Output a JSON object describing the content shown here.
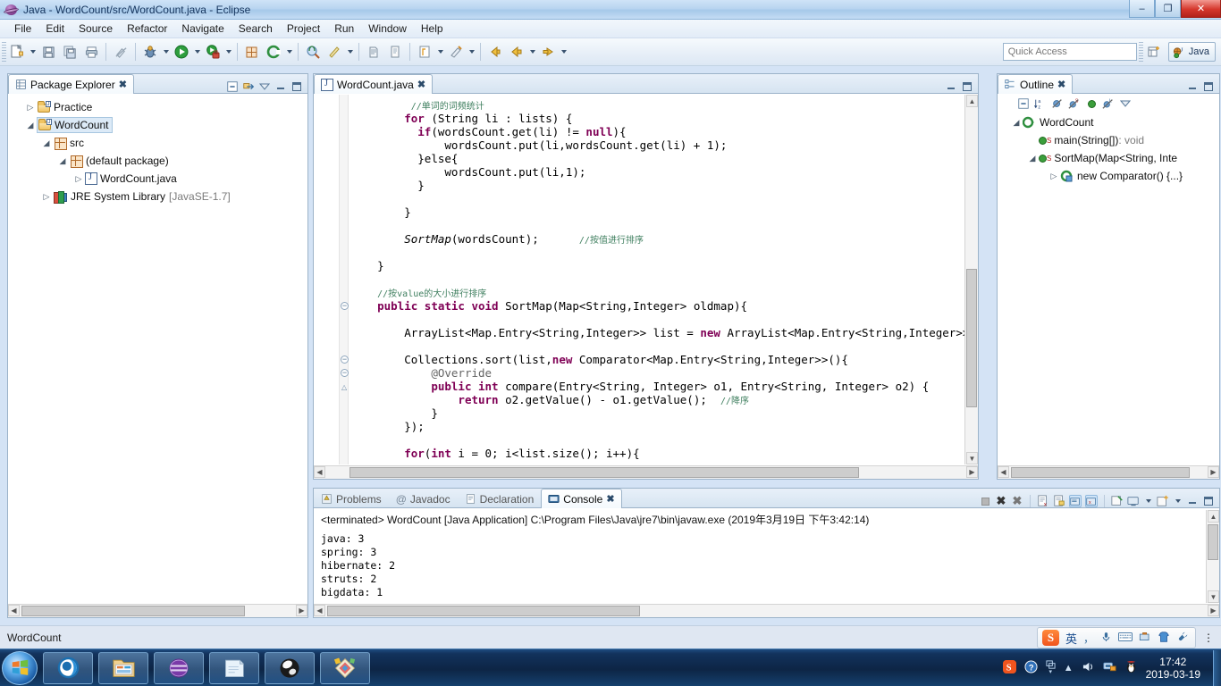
{
  "window": {
    "title": "Java - WordCount/src/WordCount.java - Eclipse",
    "minimize": "–",
    "maximize": "❐",
    "close": "✕"
  },
  "menubar": {
    "items": [
      "File",
      "Edit",
      "Source",
      "Refactor",
      "Navigate",
      "Search",
      "Project",
      "Run",
      "Window",
      "Help"
    ]
  },
  "toolbar": {
    "quick_access_placeholder": "Quick Access",
    "perspective_label": "Java"
  },
  "package_explorer": {
    "tab_label": "Package Explorer",
    "close_glyph": "✖",
    "tree": [
      {
        "label": "Practice",
        "indent": 0,
        "twist": "▷",
        "icon": "project-folder-icon",
        "selected": false,
        "dim": ""
      },
      {
        "label": "WordCount",
        "indent": 0,
        "twist": "◢",
        "icon": "project-folder-icon",
        "selected": true,
        "dim": ""
      },
      {
        "label": "src",
        "indent": 1,
        "twist": "◢",
        "icon": "source-folder-icon",
        "selected": false,
        "dim": ""
      },
      {
        "label": "(default package)",
        "indent": 2,
        "twist": "◢",
        "icon": "package-icon",
        "selected": false,
        "dim": ""
      },
      {
        "label": "WordCount.java",
        "indent": 3,
        "twist": "▷",
        "icon": "java-file-icon",
        "selected": false,
        "dim": ""
      },
      {
        "label": "JRE System Library",
        "indent": 1,
        "twist": "▷",
        "icon": "jre-library-icon",
        "selected": false,
        "dim": "[JavaSE-1.7]"
      }
    ]
  },
  "editor": {
    "tab_label": "WordCount.java",
    "close_glyph": "✖",
    "code_lines": [
      {
        "indent": 9,
        "tokens": [
          {
            "t": "//单词的词频统计",
            "c": "cz"
          }
        ]
      },
      {
        "indent": 8,
        "tokens": [
          {
            "t": "for",
            "c": "k"
          },
          {
            "t": " (String li : lists) {",
            "c": "p"
          }
        ]
      },
      {
        "indent": 10,
        "tokens": [
          {
            "t": "if",
            "c": "k"
          },
          {
            "t": "(wordsCount.get(li) != ",
            "c": "p"
          },
          {
            "t": "null",
            "c": "k"
          },
          {
            "t": "){",
            "c": "p"
          }
        ]
      },
      {
        "indent": 14,
        "tokens": [
          {
            "t": "wordsCount.put(li,wordsCount.get(li) + 1);",
            "c": "p"
          }
        ]
      },
      {
        "indent": 10,
        "tokens": [
          {
            "t": "}else{",
            "c": "p"
          }
        ]
      },
      {
        "indent": 14,
        "tokens": [
          {
            "t": "wordsCount.put(li,1);",
            "c": "p"
          }
        ]
      },
      {
        "indent": 10,
        "tokens": [
          {
            "t": "}",
            "c": "p"
          }
        ]
      },
      {
        "indent": 0,
        "tokens": []
      },
      {
        "indent": 8,
        "tokens": [
          {
            "t": "}",
            "c": "p"
          }
        ]
      },
      {
        "indent": 0,
        "tokens": []
      },
      {
        "indent": 8,
        "tokens": [
          {
            "t": "SortMap",
            "c": "s"
          },
          {
            "t": "(wordsCount);",
            "c": "p"
          },
          {
            "t": "      ",
            "c": "p"
          },
          {
            "t": "//按值进行排序",
            "c": "cz"
          }
        ]
      },
      {
        "indent": 0,
        "tokens": []
      },
      {
        "indent": 4,
        "tokens": [
          {
            "t": "}",
            "c": "p"
          }
        ]
      },
      {
        "indent": 0,
        "tokens": []
      },
      {
        "indent": 4,
        "tokens": [
          {
            "t": "//按value的大小进行排序",
            "c": "cz"
          }
        ]
      },
      {
        "indent": 4,
        "tokens": [
          {
            "t": "public static void",
            "c": "k"
          },
          {
            "t": " SortMap(Map<String,Integer> oldmap){",
            "c": "p"
          }
        ],
        "fold": true
      },
      {
        "indent": 0,
        "tokens": []
      },
      {
        "indent": 8,
        "tokens": [
          {
            "t": "ArrayList<Map.Entry<String,Integer>> list = ",
            "c": "p"
          },
          {
            "t": "new",
            "c": "k"
          },
          {
            "t": " ArrayList<Map.Entry<String,Integer>>(oldm",
            "c": "p"
          }
        ]
      },
      {
        "indent": 0,
        "tokens": []
      },
      {
        "indent": 8,
        "tokens": [
          {
            "t": "Collections.sort(list,",
            "c": "p"
          },
          {
            "t": "new",
            "c": "k"
          },
          {
            "t": " Comparator<Map.Entry<String,Integer>>(){",
            "c": "p"
          }
        ],
        "fold": true
      },
      {
        "indent": 12,
        "tokens": [
          {
            "t": "@Override",
            "c": "an"
          }
        ],
        "fold": true
      },
      {
        "indent": 12,
        "tokens": [
          {
            "t": "public int",
            "c": "k"
          },
          {
            "t": " compare(Entry<String, Integer> o1, Entry<String, Integer> o2) {",
            "c": "p"
          }
        ]
      },
      {
        "indent": 16,
        "tokens": [
          {
            "t": "return",
            "c": "k"
          },
          {
            "t": " o2.getValue() - o1.getValue();  ",
            "c": "p"
          },
          {
            "t": "//降序",
            "c": "cz"
          }
        ]
      },
      {
        "indent": 12,
        "tokens": [
          {
            "t": "}",
            "c": "p"
          }
        ]
      },
      {
        "indent": 8,
        "tokens": [
          {
            "t": "});",
            "c": "p"
          }
        ]
      },
      {
        "indent": 0,
        "tokens": []
      },
      {
        "indent": 8,
        "tokens": [
          {
            "t": "for",
            "c": "k"
          },
          {
            "t": "(",
            "c": "p"
          },
          {
            "t": "int",
            "c": "k"
          },
          {
            "t": " i = 0; i<list.size(); i++){",
            "c": "p"
          }
        ]
      }
    ]
  },
  "outline": {
    "tab_label": "Outline",
    "close_glyph": "✖",
    "tree": [
      {
        "label": "WordCount",
        "indent": 0,
        "twist": "◢",
        "icon": "class-icon",
        "static": false,
        "ret": ""
      },
      {
        "label": "main(String[])",
        "indent": 1,
        "twist": "",
        "icon": "method-public-icon",
        "static": true,
        "ret": " : void"
      },
      {
        "label": "SortMap(Map<String, Inte",
        "indent": 1,
        "twist": "◢",
        "icon": "method-public-icon",
        "static": true,
        "ret": ""
      },
      {
        "label": "new Comparator() {...}",
        "indent": 2,
        "twist": "▷",
        "icon": "anonymous-class-icon",
        "static": false,
        "ret": ""
      }
    ]
  },
  "console": {
    "tabs": [
      {
        "label": "Problems",
        "icon": "problems-icon",
        "active": false
      },
      {
        "label": "Javadoc",
        "icon": "javadoc-icon",
        "active": false
      },
      {
        "label": "Declaration",
        "icon": "declaration-icon",
        "active": false
      },
      {
        "label": "Console",
        "icon": "console-icon",
        "active": true
      }
    ],
    "close_glyph": "✖",
    "launch_line": "<terminated> WordCount [Java Application] C:\\Program Files\\Java\\jre7\\bin\\javaw.exe (2019年3月19日 下午3:42:14)",
    "output_lines": [
      "java: 3",
      "spring: 3",
      "hibernate: 2",
      "struts: 2",
      "bigdata: 1"
    ]
  },
  "statusbar": {
    "text": "WordCount",
    "right_glyph": "⋮"
  },
  "ime": {
    "logo": "S",
    "mode": "英",
    "items": [
      "comma-icon",
      "microphone-icon",
      "keyboard-icon",
      "toolbox-icon",
      "skin-icon",
      "settings-icon"
    ]
  },
  "taskbar": {
    "items": [
      "start-orb",
      "browser-icon",
      "explorer-icon",
      "eclipse-icon",
      "notepad-icon",
      "media-icon",
      "paint-icon"
    ],
    "tray_icons": [
      "sogou-icon",
      "help-icon",
      "network-icon",
      "arrow-up-icon",
      "volume-icon",
      "monitor-icon",
      "penguin-icon"
    ],
    "time": "17:42",
    "date": "2019-03-19"
  },
  "colors": {
    "keyword": "#7f0055",
    "comment": "#3f7f5f",
    "annotation": "#646464",
    "selection": "#dceaf7",
    "titlebar_close": "#d5372c"
  }
}
